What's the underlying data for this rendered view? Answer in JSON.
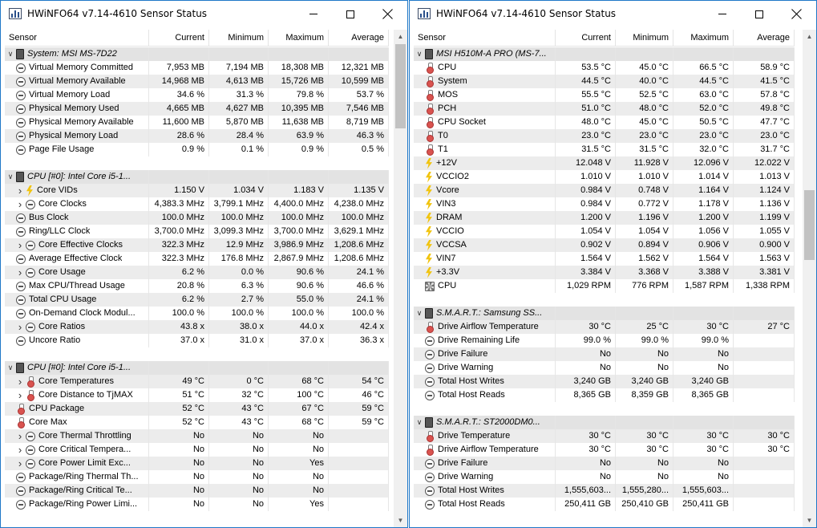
{
  "colors": {
    "accent": "#1f78c8",
    "group_row": "#e3e3e3",
    "alt_row": "#ececec"
  },
  "icons": {
    "app": "hwinfo-app-icon",
    "gauge": "gauge-icon",
    "bolt": "voltage-bolt-icon",
    "therm": "thermometer-icon",
    "chip": "chip-icon",
    "fan": "fan-icon"
  },
  "columns": {
    "sensor": "Sensor",
    "current": "Current",
    "minimum": "Minimum",
    "maximum": "Maximum",
    "average": "Average"
  },
  "windows": [
    {
      "title": "HWiNFO64 v7.14-4610 Sensor Status",
      "rows": [
        {
          "t": "group",
          "name": "System: MSI MS-7D22"
        },
        {
          "t": "item",
          "icon": "gauge",
          "name": "Virtual Memory Committed",
          "cur": "7,953 MB",
          "min": "7,194 MB",
          "max": "18,308 MB",
          "avg": "12,321 MB"
        },
        {
          "t": "item",
          "icon": "gauge",
          "name": "Virtual Memory Available",
          "cur": "14,968 MB",
          "min": "4,613 MB",
          "max": "15,726 MB",
          "avg": "10,599 MB"
        },
        {
          "t": "item",
          "icon": "gauge",
          "name": "Virtual Memory Load",
          "cur": "34.6 %",
          "min": "31.3 %",
          "max": "79.8 %",
          "avg": "53.7 %"
        },
        {
          "t": "item",
          "icon": "gauge",
          "name": "Physical Memory Used",
          "cur": "4,665 MB",
          "min": "4,627 MB",
          "max": "10,395 MB",
          "avg": "7,546 MB"
        },
        {
          "t": "item",
          "icon": "gauge",
          "name": "Physical Memory Available",
          "cur": "11,600 MB",
          "min": "5,870 MB",
          "max": "11,638 MB",
          "avg": "8,719 MB"
        },
        {
          "t": "item",
          "icon": "gauge",
          "name": "Physical Memory Load",
          "cur": "28.6 %",
          "min": "28.4 %",
          "max": "63.9 %",
          "avg": "46.3 %"
        },
        {
          "t": "item",
          "icon": "gauge",
          "name": "Page File Usage",
          "cur": "0.9 %",
          "min": "0.1 %",
          "max": "0.9 %",
          "avg": "0.5 %"
        },
        {
          "t": "blank"
        },
        {
          "t": "group",
          "name": "CPU [#0]: Intel Core i5-1..."
        },
        {
          "t": "item",
          "icon": "bolt",
          "expand": true,
          "name": "Core VIDs",
          "cur": "1.150 V",
          "min": "1.034 V",
          "max": "1.183 V",
          "avg": "1.135 V"
        },
        {
          "t": "item",
          "icon": "gauge",
          "expand": true,
          "name": "Core Clocks",
          "cur": "4,383.3 MHz",
          "min": "3,799.1 MHz",
          "max": "4,400.0 MHz",
          "avg": "4,238.0 MHz"
        },
        {
          "t": "item",
          "icon": "gauge",
          "name": "Bus Clock",
          "cur": "100.0 MHz",
          "min": "100.0 MHz",
          "max": "100.0 MHz",
          "avg": "100.0 MHz"
        },
        {
          "t": "item",
          "icon": "gauge",
          "name": "Ring/LLC Clock",
          "cur": "3,700.0 MHz",
          "min": "3,099.3 MHz",
          "max": "3,700.0 MHz",
          "avg": "3,629.1 MHz"
        },
        {
          "t": "item",
          "icon": "gauge",
          "expand": true,
          "name": "Core Effective Clocks",
          "cur": "322.3 MHz",
          "min": "12.9 MHz",
          "max": "3,986.9 MHz",
          "avg": "1,208.6 MHz"
        },
        {
          "t": "item",
          "icon": "gauge",
          "name": "Average Effective Clock",
          "cur": "322.3 MHz",
          "min": "176.8 MHz",
          "max": "2,867.9 MHz",
          "avg": "1,208.6 MHz"
        },
        {
          "t": "item",
          "icon": "gauge",
          "expand": true,
          "name": "Core Usage",
          "cur": "6.2 %",
          "min": "0.0 %",
          "max": "90.6 %",
          "avg": "24.1 %"
        },
        {
          "t": "item",
          "icon": "gauge",
          "name": "Max CPU/Thread Usage",
          "cur": "20.8 %",
          "min": "6.3 %",
          "max": "90.6 %",
          "avg": "46.6 %"
        },
        {
          "t": "item",
          "icon": "gauge",
          "name": "Total CPU Usage",
          "cur": "6.2 %",
          "min": "2.7 %",
          "max": "55.0 %",
          "avg": "24.1 %"
        },
        {
          "t": "item",
          "icon": "gauge",
          "name": "On-Demand Clock Modul...",
          "cur": "100.0 %",
          "min": "100.0 %",
          "max": "100.0 %",
          "avg": "100.0 %"
        },
        {
          "t": "item",
          "icon": "gauge",
          "expand": true,
          "name": "Core Ratios",
          "cur": "43.8 x",
          "min": "38.0 x",
          "max": "44.0 x",
          "avg": "42.4 x"
        },
        {
          "t": "item",
          "icon": "gauge",
          "name": "Uncore Ratio",
          "cur": "37.0 x",
          "min": "31.0 x",
          "max": "37.0 x",
          "avg": "36.3 x"
        },
        {
          "t": "blank"
        },
        {
          "t": "group",
          "name": "CPU [#0]: Intel Core i5-1..."
        },
        {
          "t": "item",
          "icon": "therm",
          "expand": true,
          "name": "Core Temperatures",
          "cur": "49 °C",
          "min": "0 °C",
          "max": "68 °C",
          "avg": "54 °C"
        },
        {
          "t": "item",
          "icon": "therm",
          "expand": true,
          "name": "Core Distance to TjMAX",
          "cur": "51 °C",
          "min": "32 °C",
          "max": "100 °C",
          "avg": "46 °C"
        },
        {
          "t": "item",
          "icon": "therm",
          "name": "CPU Package",
          "cur": "52 °C",
          "min": "43 °C",
          "max": "67 °C",
          "avg": "59 °C"
        },
        {
          "t": "item",
          "icon": "therm",
          "name": "Core Max",
          "cur": "52 °C",
          "min": "43 °C",
          "max": "68 °C",
          "avg": "59 °C"
        },
        {
          "t": "item",
          "icon": "gauge",
          "expand": true,
          "name": "Core Thermal Throttling",
          "cur": "No",
          "min": "No",
          "max": "No",
          "avg": ""
        },
        {
          "t": "item",
          "icon": "gauge",
          "expand": true,
          "name": "Core Critical Tempera...",
          "cur": "No",
          "min": "No",
          "max": "No",
          "avg": ""
        },
        {
          "t": "item",
          "icon": "gauge",
          "expand": true,
          "name": "Core Power Limit Exc...",
          "cur": "No",
          "min": "No",
          "max": "Yes",
          "avg": ""
        },
        {
          "t": "item",
          "icon": "gauge",
          "name": "Package/Ring Thermal Th...",
          "cur": "No",
          "min": "No",
          "max": "No",
          "avg": ""
        },
        {
          "t": "item",
          "icon": "gauge",
          "name": "Package/Ring Critical Te...",
          "cur": "No",
          "min": "No",
          "max": "No",
          "avg": ""
        },
        {
          "t": "item",
          "icon": "gauge",
          "name": "Package/Ring Power Limi...",
          "cur": "No",
          "min": "No",
          "max": "Yes",
          "avg": ""
        }
      ]
    },
    {
      "title": "HWiNFO64 v7.14-4610 Sensor Status",
      "rows": [
        {
          "t": "group",
          "name": "MSI H510M-A PRO (MS-7..."
        },
        {
          "t": "item",
          "icon": "therm",
          "name": "CPU",
          "cur": "53.5 °C",
          "min": "45.0 °C",
          "max": "66.5 °C",
          "avg": "58.9 °C"
        },
        {
          "t": "item",
          "icon": "therm",
          "name": "System",
          "cur": "44.5 °C",
          "min": "40.0 °C",
          "max": "44.5 °C",
          "avg": "41.5 °C"
        },
        {
          "t": "item",
          "icon": "therm",
          "name": "MOS",
          "cur": "55.5 °C",
          "min": "52.5 °C",
          "max": "63.0 °C",
          "avg": "57.8 °C"
        },
        {
          "t": "item",
          "icon": "therm",
          "name": "PCH",
          "cur": "51.0 °C",
          "min": "48.0 °C",
          "max": "52.0 °C",
          "avg": "49.8 °C"
        },
        {
          "t": "item",
          "icon": "therm",
          "name": "CPU Socket",
          "cur": "48.0 °C",
          "min": "45.0 °C",
          "max": "50.5 °C",
          "avg": "47.7 °C"
        },
        {
          "t": "item",
          "icon": "therm",
          "name": "T0",
          "cur": "23.0 °C",
          "min": "23.0 °C",
          "max": "23.0 °C",
          "avg": "23.0 °C"
        },
        {
          "t": "item",
          "icon": "therm",
          "name": "T1",
          "cur": "31.5 °C",
          "min": "31.5 °C",
          "max": "32.0 °C",
          "avg": "31.7 °C"
        },
        {
          "t": "item",
          "icon": "bolt",
          "name": "+12V",
          "cur": "12.048 V",
          "min": "11.928 V",
          "max": "12.096 V",
          "avg": "12.022 V"
        },
        {
          "t": "item",
          "icon": "bolt",
          "name": "VCCIO2",
          "cur": "1.010 V",
          "min": "1.010 V",
          "max": "1.014 V",
          "avg": "1.013 V"
        },
        {
          "t": "item",
          "icon": "bolt",
          "name": "Vcore",
          "cur": "0.984 V",
          "min": "0.748 V",
          "max": "1.164 V",
          "avg": "1.124 V"
        },
        {
          "t": "item",
          "icon": "bolt",
          "name": "VIN3",
          "cur": "0.984 V",
          "min": "0.772 V",
          "max": "1.178 V",
          "avg": "1.136 V"
        },
        {
          "t": "item",
          "icon": "bolt",
          "name": "DRAM",
          "cur": "1.200 V",
          "min": "1.196 V",
          "max": "1.200 V",
          "avg": "1.199 V"
        },
        {
          "t": "item",
          "icon": "bolt",
          "name": "VCCIO",
          "cur": "1.054 V",
          "min": "1.054 V",
          "max": "1.056 V",
          "avg": "1.055 V"
        },
        {
          "t": "item",
          "icon": "bolt",
          "name": "VCCSA",
          "cur": "0.902 V",
          "min": "0.894 V",
          "max": "0.906 V",
          "avg": "0.900 V"
        },
        {
          "t": "item",
          "icon": "bolt",
          "name": "VIN7",
          "cur": "1.564 V",
          "min": "1.562 V",
          "max": "1.564 V",
          "avg": "1.563 V"
        },
        {
          "t": "item",
          "icon": "bolt",
          "name": "+3.3V",
          "cur": "3.384 V",
          "min": "3.368 V",
          "max": "3.388 V",
          "avg": "3.381 V"
        },
        {
          "t": "item",
          "icon": "fan",
          "name": "CPU",
          "cur": "1,029 RPM",
          "min": "776 RPM",
          "max": "1,587 RPM",
          "avg": "1,338 RPM"
        },
        {
          "t": "blank"
        },
        {
          "t": "group",
          "name": "S.M.A.R.T.: Samsung SS..."
        },
        {
          "t": "item",
          "icon": "therm",
          "name": "Drive Airflow Temperature",
          "cur": "30 °C",
          "min": "25 °C",
          "max": "30 °C",
          "avg": "27 °C"
        },
        {
          "t": "item",
          "icon": "gauge",
          "name": "Drive Remaining Life",
          "cur": "99.0 %",
          "min": "99.0 %",
          "max": "99.0 %",
          "avg": ""
        },
        {
          "t": "item",
          "icon": "gauge",
          "name": "Drive Failure",
          "cur": "No",
          "min": "No",
          "max": "No",
          "avg": ""
        },
        {
          "t": "item",
          "icon": "gauge",
          "name": "Drive Warning",
          "cur": "No",
          "min": "No",
          "max": "No",
          "avg": ""
        },
        {
          "t": "item",
          "icon": "gauge",
          "name": "Total Host Writes",
          "cur": "3,240 GB",
          "min": "3,240 GB",
          "max": "3,240 GB",
          "avg": ""
        },
        {
          "t": "item",
          "icon": "gauge",
          "name": "Total Host Reads",
          "cur": "8,365 GB",
          "min": "8,359 GB",
          "max": "8,365 GB",
          "avg": ""
        },
        {
          "t": "blank"
        },
        {
          "t": "group",
          "name": "S.M.A.R.T.: ST2000DM0..."
        },
        {
          "t": "item",
          "icon": "therm",
          "name": "Drive Temperature",
          "cur": "30 °C",
          "min": "30 °C",
          "max": "30 °C",
          "avg": "30 °C"
        },
        {
          "t": "item",
          "icon": "therm",
          "name": "Drive Airflow Temperature",
          "cur": "30 °C",
          "min": "30 °C",
          "max": "30 °C",
          "avg": "30 °C"
        },
        {
          "t": "item",
          "icon": "gauge",
          "name": "Drive Failure",
          "cur": "No",
          "min": "No",
          "max": "No",
          "avg": ""
        },
        {
          "t": "item",
          "icon": "gauge",
          "name": "Drive Warning",
          "cur": "No",
          "min": "No",
          "max": "No",
          "avg": ""
        },
        {
          "t": "item",
          "icon": "gauge",
          "name": "Total Host Writes",
          "cur": "1,555,603...",
          "min": "1,555,280...",
          "max": "1,555,603...",
          "avg": ""
        },
        {
          "t": "item",
          "icon": "gauge",
          "name": "Total Host Reads",
          "cur": "250,411 GB",
          "min": "250,410 GB",
          "max": "250,411 GB",
          "avg": ""
        }
      ]
    }
  ]
}
